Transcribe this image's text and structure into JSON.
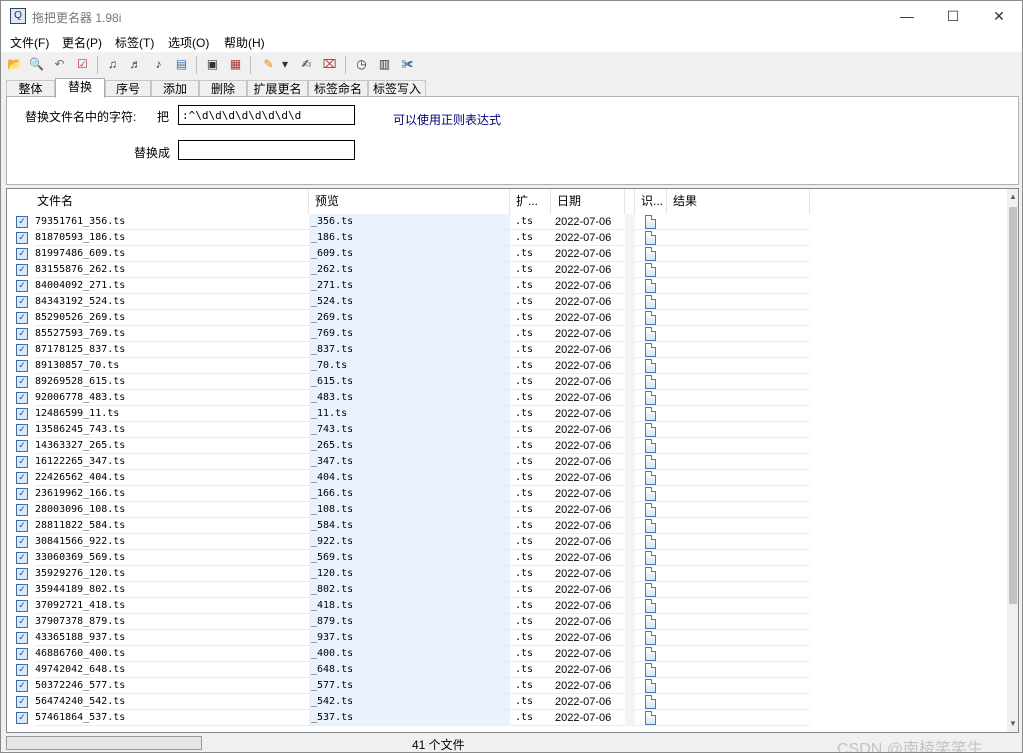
{
  "window": {
    "title": "拖把更名器 1.98i",
    "app_icon_glyph": "Q",
    "minimize": "—",
    "maximize": "☐",
    "close": "✕"
  },
  "menu": [
    "文件(F)",
    "更名(P)",
    "标签(T)",
    "选项(O)",
    "帮助(H)"
  ],
  "toolbar": [
    {
      "icon": "open-folder-icon",
      "glyph": "📂"
    },
    {
      "icon": "search-icon",
      "glyph": "🔍"
    },
    {
      "icon": "undo-icon",
      "glyph": "↶"
    },
    {
      "icon": "check-icon",
      "glyph": "☑"
    },
    {
      "icon": "tag-music-icon",
      "glyph": "♫"
    },
    {
      "icon": "tag-music-edit-icon",
      "glyph": "♬"
    },
    {
      "icon": "tag-music-write-icon",
      "glyph": "♪"
    },
    {
      "icon": "note-icon",
      "glyph": "▤"
    },
    {
      "icon": "document-icon",
      "glyph": "▣"
    },
    {
      "icon": "report-icon",
      "glyph": "▦"
    },
    {
      "icon": "brush-icon",
      "glyph": "✎"
    },
    {
      "icon": "dropdown-arrow-icon",
      "glyph": "▾"
    },
    {
      "icon": "rename-icon",
      "glyph": "✍"
    },
    {
      "icon": "rename-clear-icon",
      "glyph": "⌧"
    },
    {
      "icon": "clock-icon",
      "glyph": "◷"
    },
    {
      "icon": "view-icon",
      "glyph": "▥"
    },
    {
      "icon": "tools-icon",
      "glyph": "✀"
    }
  ],
  "tabs": [
    "整体",
    "替换",
    "序号",
    "添加",
    "删除",
    "扩展更名",
    "标签命名",
    "标签写入"
  ],
  "active_tab": 1,
  "replace_panel": {
    "find_label": "替换文件名中的字符:",
    "prefix": "把",
    "find_value": ":^\\d\\d\\d\\d\\d\\d\\d\\d",
    "replace_label": "替换成",
    "replace_value": "",
    "hint": "可以使用正则表达式"
  },
  "columns": [
    "文件名",
    "预览",
    "扩...",
    "日期",
    "识...",
    "结果"
  ],
  "rows": [
    {
      "name": "79351761_356.ts",
      "preview": "_356.ts",
      "ext": ".ts",
      "date": "2022-07-06"
    },
    {
      "name": "81870593_186.ts",
      "preview": "_186.ts",
      "ext": ".ts",
      "date": "2022-07-06"
    },
    {
      "name": "81997486_609.ts",
      "preview": "_609.ts",
      "ext": ".ts",
      "date": "2022-07-06"
    },
    {
      "name": "83155876_262.ts",
      "preview": "_262.ts",
      "ext": ".ts",
      "date": "2022-07-06"
    },
    {
      "name": "84004092_271.ts",
      "preview": "_271.ts",
      "ext": ".ts",
      "date": "2022-07-06"
    },
    {
      "name": "84343192_524.ts",
      "preview": "_524.ts",
      "ext": ".ts",
      "date": "2022-07-06"
    },
    {
      "name": "85290526_269.ts",
      "preview": "_269.ts",
      "ext": ".ts",
      "date": "2022-07-06"
    },
    {
      "name": "85527593_769.ts",
      "preview": "_769.ts",
      "ext": ".ts",
      "date": "2022-07-06"
    },
    {
      "name": "87178125_837.ts",
      "preview": "_837.ts",
      "ext": ".ts",
      "date": "2022-07-06"
    },
    {
      "name": "89130857_70.ts",
      "preview": "_70.ts",
      "ext": ".ts",
      "date": "2022-07-06"
    },
    {
      "name": "89269528_615.ts",
      "preview": "_615.ts",
      "ext": ".ts",
      "date": "2022-07-06"
    },
    {
      "name": "92006778_483.ts",
      "preview": "_483.ts",
      "ext": ".ts",
      "date": "2022-07-06"
    },
    {
      "name": "12486599_11.ts",
      "preview": "_11.ts",
      "ext": ".ts",
      "date": "2022-07-06"
    },
    {
      "name": "13586245_743.ts",
      "preview": "_743.ts",
      "ext": ".ts",
      "date": "2022-07-06"
    },
    {
      "name": "14363327_265.ts",
      "preview": "_265.ts",
      "ext": ".ts",
      "date": "2022-07-06"
    },
    {
      "name": "16122265_347.ts",
      "preview": "_347.ts",
      "ext": ".ts",
      "date": "2022-07-06"
    },
    {
      "name": "22426562_404.ts",
      "preview": "_404.ts",
      "ext": ".ts",
      "date": "2022-07-06"
    },
    {
      "name": "23619962_166.ts",
      "preview": "_166.ts",
      "ext": ".ts",
      "date": "2022-07-06"
    },
    {
      "name": "28003096_108.ts",
      "preview": "_108.ts",
      "ext": ".ts",
      "date": "2022-07-06"
    },
    {
      "name": "28811822_584.ts",
      "preview": "_584.ts",
      "ext": ".ts",
      "date": "2022-07-06"
    },
    {
      "name": "30841566_922.ts",
      "preview": "_922.ts",
      "ext": ".ts",
      "date": "2022-07-06"
    },
    {
      "name": "33060369_569.ts",
      "preview": "_569.ts",
      "ext": ".ts",
      "date": "2022-07-06"
    },
    {
      "name": "35929276_120.ts",
      "preview": "_120.ts",
      "ext": ".ts",
      "date": "2022-07-06"
    },
    {
      "name": "35944189_802.ts",
      "preview": "_802.ts",
      "ext": ".ts",
      "date": "2022-07-06"
    },
    {
      "name": "37092721_418.ts",
      "preview": "_418.ts",
      "ext": ".ts",
      "date": "2022-07-06"
    },
    {
      "name": "37907378_879.ts",
      "preview": "_879.ts",
      "ext": ".ts",
      "date": "2022-07-06"
    },
    {
      "name": "43365188_937.ts",
      "preview": "_937.ts",
      "ext": ".ts",
      "date": "2022-07-06"
    },
    {
      "name": "46886760_400.ts",
      "preview": "_400.ts",
      "ext": ".ts",
      "date": "2022-07-06"
    },
    {
      "name": "49742042_648.ts",
      "preview": "_648.ts",
      "ext": ".ts",
      "date": "2022-07-06"
    },
    {
      "name": "50372246_577.ts",
      "preview": "_577.ts",
      "ext": ".ts",
      "date": "2022-07-06"
    },
    {
      "name": "56474240_542.ts",
      "preview": "_542.ts",
      "ext": ".ts",
      "date": "2022-07-06"
    },
    {
      "name": "57461864_537.ts",
      "preview": "_537.ts",
      "ext": ".ts",
      "date": "2022-07-06"
    }
  ],
  "status": {
    "file_count": "41 个文件",
    "progress": 0
  },
  "watermark": "CSDN @南棱笑笑生"
}
